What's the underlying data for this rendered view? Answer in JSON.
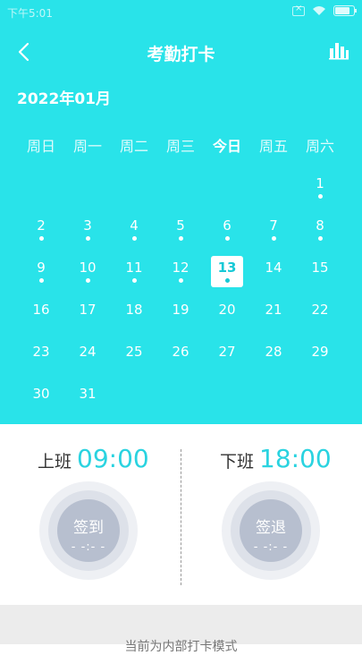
{
  "status_bar": {
    "time": "下午5:01"
  },
  "header": {
    "title": "考勤打卡"
  },
  "calendar": {
    "month_label": "2022年01月",
    "weekdays": [
      "周日",
      "周一",
      "周二",
      "周三",
      "今日",
      "周五",
      "周六"
    ],
    "weeks": [
      [
        {
          "d": ""
        },
        {
          "d": ""
        },
        {
          "d": ""
        },
        {
          "d": ""
        },
        {
          "d": ""
        },
        {
          "d": ""
        },
        {
          "d": "1",
          "dot": true
        }
      ],
      [
        {
          "d": "2",
          "dot": true
        },
        {
          "d": "3",
          "dot": true
        },
        {
          "d": "4",
          "dot": true
        },
        {
          "d": "5",
          "dot": true
        },
        {
          "d": "6",
          "dot": true
        },
        {
          "d": "7",
          "dot": true
        },
        {
          "d": "8",
          "dot": true
        }
      ],
      [
        {
          "d": "9",
          "dot": true
        },
        {
          "d": "10",
          "dot": true
        },
        {
          "d": "11",
          "dot": true
        },
        {
          "d": "12",
          "dot": true
        },
        {
          "d": "13",
          "dot": true,
          "today": true
        },
        {
          "d": "14"
        },
        {
          "d": "15"
        }
      ],
      [
        {
          "d": "16"
        },
        {
          "d": "17"
        },
        {
          "d": "18"
        },
        {
          "d": "19"
        },
        {
          "d": "20"
        },
        {
          "d": "21"
        },
        {
          "d": "22"
        }
      ],
      [
        {
          "d": "23"
        },
        {
          "d": "24"
        },
        {
          "d": "25"
        },
        {
          "d": "26"
        },
        {
          "d": "27"
        },
        {
          "d": "28"
        },
        {
          "d": "29"
        }
      ],
      [
        {
          "d": "30"
        },
        {
          "d": "31"
        },
        {
          "d": ""
        },
        {
          "d": ""
        },
        {
          "d": ""
        },
        {
          "d": ""
        },
        {
          "d": ""
        }
      ]
    ]
  },
  "attendance": {
    "on_duty": {
      "label": "上班",
      "time": "09:00",
      "button": "签到",
      "value": "- -:- -"
    },
    "off_duty": {
      "label": "下班",
      "time": "18:00",
      "button": "签退",
      "value": "- -:- -"
    }
  },
  "footer": {
    "text": "当前为内部打卡模式"
  },
  "colors": {
    "accent": "#29e3e9",
    "time_text": "#2ad3e0",
    "button": "#b7bfcf"
  },
  "icons": {
    "back": "chevron-left-icon",
    "stats": "bar-chart-icon",
    "wifi": "wifi-icon",
    "battery": "battery-icon",
    "sim": "sim-off-icon"
  }
}
